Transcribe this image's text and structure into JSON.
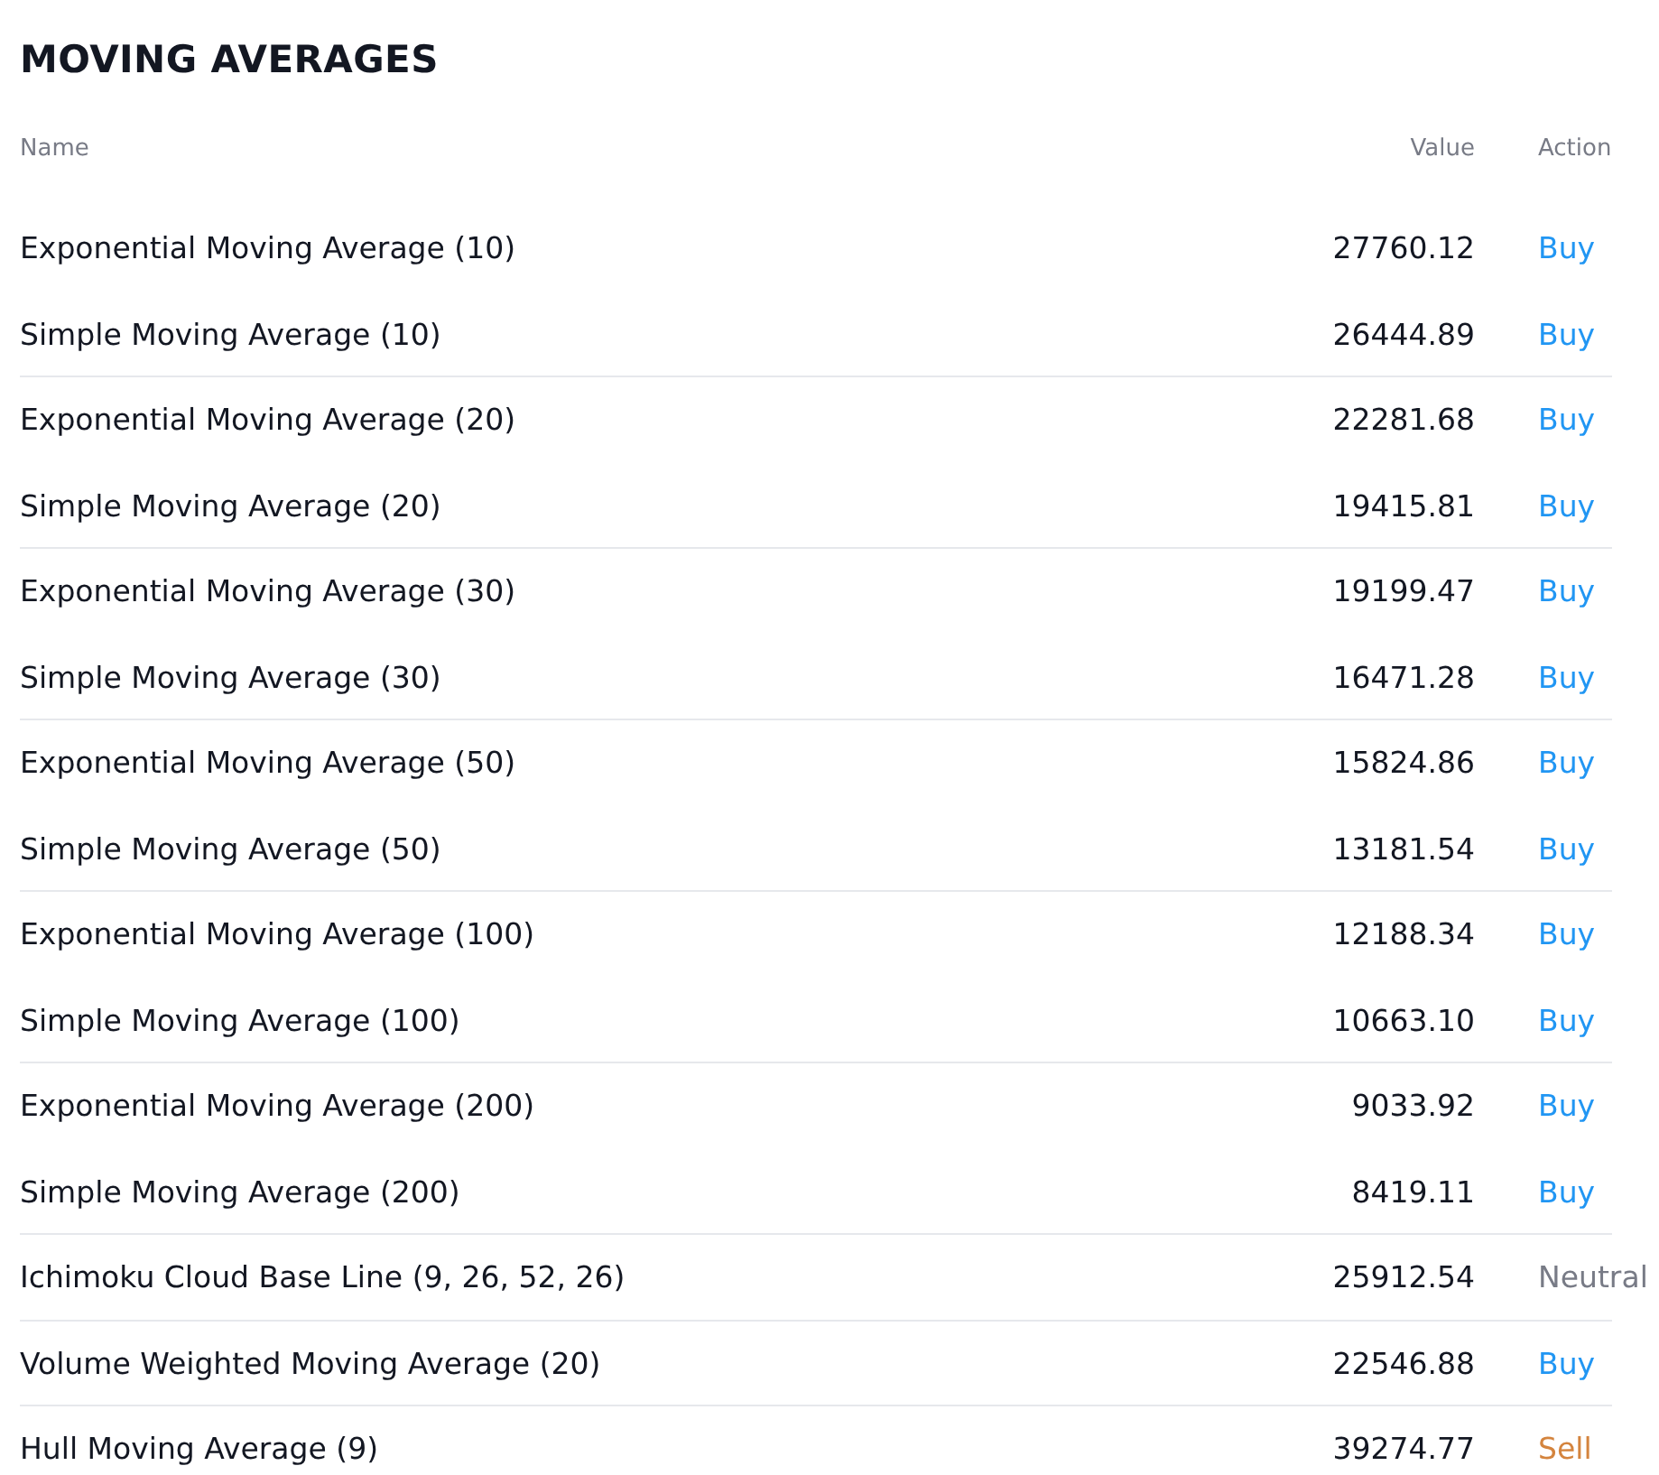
{
  "title": "MOVING AVERAGES",
  "columns": [
    "Name",
    "Value",
    "Action"
  ],
  "rows": [
    {
      "name": "Exponential Moving Average (10)",
      "value": "27760.12",
      "action": "Buy",
      "color": "#2196f3",
      "divider": false
    },
    {
      "name": "Simple Moving Average (10)",
      "value": "26444.89",
      "action": "Buy",
      "color": "#2196f3",
      "divider": true
    },
    {
      "name": "Exponential Moving Average (20)",
      "value": "22281.68",
      "action": "Buy",
      "color": "#2196f3",
      "divider": false
    },
    {
      "name": "Simple Moving Average (20)",
      "value": "19415.81",
      "action": "Buy",
      "color": "#2196f3",
      "divider": true
    },
    {
      "name": "Exponential Moving Average (30)",
      "value": "19199.47",
      "action": "Buy",
      "color": "#2196f3",
      "divider": false
    },
    {
      "name": "Simple Moving Average (30)",
      "value": "16471.28",
      "action": "Buy",
      "color": "#2196f3",
      "divider": true
    },
    {
      "name": "Exponential Moving Average (50)",
      "value": "15824.86",
      "action": "Buy",
      "color": "#2196f3",
      "divider": false
    },
    {
      "name": "Simple Moving Average (50)",
      "value": "13181.54",
      "action": "Buy",
      "color": "#2196f3",
      "divider": true
    },
    {
      "name": "Exponential Moving Average (100)",
      "value": "12188.34",
      "action": "Buy",
      "color": "#2196f3",
      "divider": false
    },
    {
      "name": "Simple Moving Average (100)",
      "value": "10663.10",
      "action": "Buy",
      "color": "#2196f3",
      "divider": true
    },
    {
      "name": "Exponential Moving Average (200)",
      "value": "9033.92",
      "action": "Buy",
      "color": "#2196f3",
      "divider": false
    },
    {
      "name": "Simple Moving Average (200)",
      "value": "8419.11",
      "action": "Buy",
      "color": "#2196f3",
      "divider": true
    },
    {
      "name": "Ichimoku Cloud Base Line (9, 26, 52, 26)",
      "value": "25912.54",
      "action": "Neutral",
      "color": "#787b86",
      "divider": true
    },
    {
      "name": "Volume Weighted Moving Average (20)",
      "value": "22546.88",
      "action": "Buy",
      "color": "#2196f3",
      "divider": true
    },
    {
      "name": "Hull Moving Average (9)",
      "value": "39274.77",
      "action": "Sell",
      "color": "#d4843e",
      "divider": false
    }
  ]
}
